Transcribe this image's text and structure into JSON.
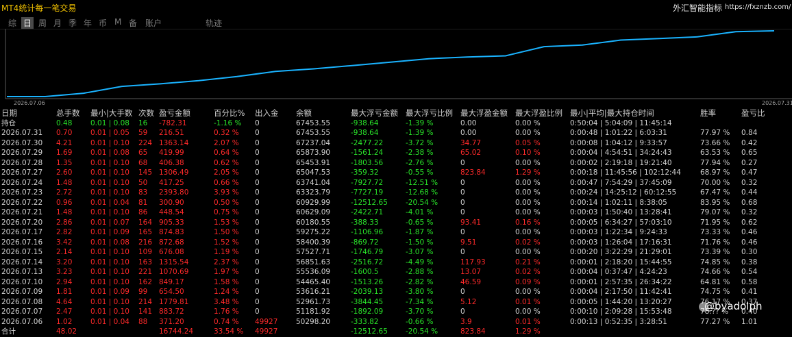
{
  "app": {
    "title": "MT4统计每一笔交易",
    "brand_name": "外汇智能指标",
    "brand_url": "https://fxznzb.com/"
  },
  "tabs": [
    {
      "label": "综",
      "active": false
    },
    {
      "label": "日",
      "active": true
    },
    {
      "label": "周",
      "active": false
    },
    {
      "label": "月",
      "active": false
    },
    {
      "label": "季",
      "active": false
    },
    {
      "label": "年",
      "active": false
    },
    {
      "label": "币",
      "active": false
    },
    {
      "label": "M",
      "active": false
    },
    {
      "label": "备",
      "active": false
    },
    {
      "label": "账户",
      "active": false
    },
    {
      "label": "轨迹",
      "active": false
    }
  ],
  "chart_data": {
    "type": "line",
    "x_start_label": "2026.07.06",
    "x_end_label": "2026.07.31",
    "x": [
      "2026.07.06",
      "2026.07.07",
      "2026.07.08",
      "2026.07.09",
      "2026.07.10",
      "2026.07.13",
      "2026.07.14",
      "2026.07.15",
      "2026.07.16",
      "2026.07.17",
      "2026.07.20",
      "2026.07.21",
      "2026.07.22",
      "2026.07.23",
      "2026.07.24",
      "2026.07.27",
      "2026.07.28",
      "2026.07.29",
      "2026.07.30",
      "2026.07.31"
    ],
    "series": [
      {
        "color": "#1ab3ff",
        "values": [
          50298.2,
          50298.2,
          51181.92,
          52961.73,
          53616.21,
          54465.4,
          55536.09,
          56851.63,
          57527.71,
          58400.39,
          59275.22,
          60180.55,
          60629.09,
          60929.99,
          63323.79,
          63741.04,
          65047.53,
          65453.91,
          65873.9,
          67237.04,
          67453.55
        ]
      }
    ],
    "grid": false
  },
  "table": {
    "headers": [
      "日期",
      "总手数",
      "最小|大手数",
      "次数",
      "盈亏金额",
      "百分比%",
      "出入金",
      "余额",
      "最大浮亏金额",
      "最大浮亏比例",
      "最大浮盈金额",
      "最大浮盈比例",
      "最小|平均|最大持仓时间",
      "胜率",
      "盈亏比"
    ],
    "holding": {
      "label": "持仓",
      "cells": [
        {
          "v": "0.48",
          "c": "green"
        },
        {
          "v": "0.01 | 0.08",
          "c": "green"
        },
        {
          "v": "16",
          "c": "green"
        },
        {
          "v": "-782.31",
          "c": "red"
        },
        {
          "v": "-1.16 %",
          "c": "green"
        },
        {
          "v": "0",
          "c": "white"
        },
        {
          "v": "67453.55",
          "c": "white"
        },
        {
          "v": "-938.64",
          "c": "green"
        },
        {
          "v": "-1.39 %",
          "c": "green"
        },
        {
          "v": "0.00",
          "c": "white"
        },
        {
          "v": "0.00 %",
          "c": "white"
        },
        {
          "v": "0:50:04 | 5:04:09 | 11:45:14",
          "c": "white"
        },
        {
          "v": "",
          "c": "white"
        },
        {
          "v": "",
          "c": "white"
        }
      ]
    },
    "rows": [
      {
        "date": "2026.07.31",
        "lots": "0.70",
        "minmax": "0.01 | 0.05",
        "count": "59",
        "pnl": "216.51",
        "pct": "0.32 %",
        "dep": "0",
        "bal": "67453.55",
        "mfl": "-938.64",
        "mflp": "-1.39 %",
        "mfp": "0.00",
        "mfpp": "0.00 %",
        "time": "0:00:48 | 1:01:22 | 6:03:31",
        "win": "77.97 %",
        "pr": "0.84",
        "mfp_c": "white",
        "mfpp_c": "white"
      },
      {
        "date": "2026.07.30",
        "lots": "4.21",
        "minmax": "0.01 | 0.10",
        "count": "224",
        "pnl": "1363.14",
        "pct": "2.07 %",
        "dep": "0",
        "bal": "67237.04",
        "mfl": "-2477.22",
        "mflp": "-3.72 %",
        "mfp": "34.77",
        "mfpp": "0.05 %",
        "time": "0:00:08 | 1:04:12 | 9:33:57",
        "win": "73.66 %",
        "pr": "0.42",
        "mfp_c": "red",
        "mfpp_c": "red"
      },
      {
        "date": "2026.07.29",
        "lots": "1.69",
        "minmax": "0.01 | 0.08",
        "count": "65",
        "pnl": "419.99",
        "pct": "0.64 %",
        "dep": "0",
        "bal": "65873.90",
        "mfl": "-1561.24",
        "mflp": "-2.38 %",
        "mfp": "65.02",
        "mfpp": "0.10 %",
        "time": "0:00:04 | 4:54:51 | 34:24:43",
        "win": "63.53 %",
        "pr": "0.65",
        "mfp_c": "red",
        "mfpp_c": "red"
      },
      {
        "date": "2026.07.28",
        "lots": "1.35",
        "minmax": "0.01 | 0.10",
        "count": "68",
        "pnl": "406.38",
        "pct": "0.62 %",
        "dep": "0",
        "bal": "65453.91",
        "mfl": "-1803.56",
        "mflp": "-2.76 %",
        "mfp": "0",
        "mfpp": "0.00 %",
        "time": "0:00:02 | 2:19:18 | 19:21:40",
        "win": "77.94 %",
        "pr": "0.27",
        "mfp_c": "white",
        "mfpp_c": "white"
      },
      {
        "date": "2026.07.27",
        "lots": "2.60",
        "minmax": "0.01 | 0.10",
        "count": "145",
        "pnl": "1306.49",
        "pct": "2.05 %",
        "dep": "0",
        "bal": "65047.53",
        "mfl": "-359.32",
        "mflp": "-0.55 %",
        "mfp": "823.84",
        "mfpp": "1.29 %",
        "time": "0:00:18 | 11:45:56 | 102:12:44",
        "win": "68.97 %",
        "pr": "0.47",
        "mfp_c": "red",
        "mfpp_c": "red"
      },
      {
        "date": "2026.07.24",
        "lots": "1.48",
        "minmax": "0.01 | 0.10",
        "count": "50",
        "pnl": "417.25",
        "pct": "0.66 %",
        "dep": "0",
        "bal": "63741.04",
        "mfl": "-7927.72",
        "mflp": "-12.51 %",
        "mfp": "0",
        "mfpp": "0.00 %",
        "time": "0:00:47 | 7:54:29 | 37:45:09",
        "win": "70.00 %",
        "pr": "0.32",
        "mfp_c": "white",
        "mfpp_c": "white"
      },
      {
        "date": "2026.07.23",
        "lots": "2.72",
        "minmax": "0.01 | 0.10",
        "count": "83",
        "pnl": "2393.80",
        "pct": "3.93 %",
        "dep": "0",
        "bal": "63323.79",
        "mfl": "-7727.19",
        "mflp": "-12.68 %",
        "mfp": "0",
        "mfpp": "0.00 %",
        "time": "0:00:24 | 14:25:12 | 60:12:55",
        "win": "67.47 %",
        "pr": "0.44",
        "mfp_c": "white",
        "mfpp_c": "white"
      },
      {
        "date": "2026.07.22",
        "lots": "0.96",
        "minmax": "0.01 | 0.04",
        "count": "81",
        "pnl": "300.90",
        "pct": "0.50 %",
        "dep": "0",
        "bal": "60929.99",
        "mfl": "-12512.65",
        "mflp": "-20.54 %",
        "mfp": "0",
        "mfpp": "0.00 %",
        "time": "0:00:14 | 1:02:11 | 8:38:05",
        "win": "83.95 %",
        "pr": "0.68",
        "mfp_c": "white",
        "mfpp_c": "white"
      },
      {
        "date": "2026.07.21",
        "lots": "1.48",
        "minmax": "0.01 | 0.10",
        "count": "86",
        "pnl": "448.54",
        "pct": "0.75 %",
        "dep": "0",
        "bal": "60629.09",
        "mfl": "-2422.71",
        "mflp": "-4.01 %",
        "mfp": "0",
        "mfpp": "0.00 %",
        "time": "0:00:03 | 1:50:40 | 13:28:41",
        "win": "79.07 %",
        "pr": "0.32",
        "mfp_c": "white",
        "mfpp_c": "white"
      },
      {
        "date": "2026.07.20",
        "lots": "2.86",
        "minmax": "0.01 | 0.07",
        "count": "164",
        "pnl": "905.33",
        "pct": "1.53 %",
        "dep": "0",
        "bal": "60180.55",
        "mfl": "-388.33",
        "mflp": "-0.65 %",
        "mfp": "93.41",
        "mfpp": "0.16 %",
        "time": "0:00:05 | 6:34:27 | 57:03:10",
        "win": "71.95 %",
        "pr": "0.62",
        "mfp_c": "red",
        "mfpp_c": "red"
      },
      {
        "date": "2026.07.17",
        "lots": "2.82",
        "minmax": "0.01 | 0.09",
        "count": "165",
        "pnl": "874.83",
        "pct": "1.50 %",
        "dep": "0",
        "bal": "59275.22",
        "mfl": "-1106.96",
        "mflp": "-1.87 %",
        "mfp": "0",
        "mfpp": "0.00 %",
        "time": "0:00:03 | 1:22:34 | 9:24:33",
        "win": "73.33 %",
        "pr": "0.46",
        "mfp_c": "white",
        "mfpp_c": "white"
      },
      {
        "date": "2026.07.16",
        "lots": "3.42",
        "minmax": "0.01 | 0.08",
        "count": "216",
        "pnl": "872.68",
        "pct": "1.52 %",
        "dep": "0",
        "bal": "58400.39",
        "mfl": "-869.72",
        "mflp": "-1.50 %",
        "mfp": "9.51",
        "mfpp": "0.02 %",
        "time": "0:00:03 | 1:26:04 | 17:16:31",
        "win": "71.76 %",
        "pr": "0.46",
        "mfp_c": "red",
        "mfpp_c": "red"
      },
      {
        "date": "2026.07.15",
        "lots": "2.14",
        "minmax": "0.01 | 0.10",
        "count": "109",
        "pnl": "676.08",
        "pct": "1.19 %",
        "dep": "0",
        "bal": "57527.71",
        "mfl": "-1746.79",
        "mflp": "-3.07 %",
        "mfp": "0",
        "mfpp": "0.00 %",
        "time": "0:00:20 | 3:22:29 | 21:29:01",
        "win": "73.39 %",
        "pr": "0.30",
        "mfp_c": "white",
        "mfpp_c": "white"
      },
      {
        "date": "2026.07.14",
        "lots": "3.20",
        "minmax": "0.01 | 0.10",
        "count": "163",
        "pnl": "1315.54",
        "pct": "2.37 %",
        "dep": "0",
        "bal": "56851.63",
        "mfl": "-2516.72",
        "mflp": "-4.49 %",
        "mfp": "117.93",
        "mfpp": "0.21 %",
        "time": "0:00:01 | 2:18:20 | 15:44:55",
        "win": "74.85 %",
        "pr": "0.38",
        "mfp_c": "red",
        "mfpp_c": "red"
      },
      {
        "date": "2026.07.13",
        "lots": "3.23",
        "minmax": "0.01 | 0.10",
        "count": "221",
        "pnl": "1070.69",
        "pct": "1.97 %",
        "dep": "0",
        "bal": "55536.09",
        "mfl": "-1600.5",
        "mflp": "-2.88 %",
        "mfp": "13.07",
        "mfpp": "0.02 %",
        "time": "0:00:04 | 0:37:47 | 4:24:23",
        "win": "74.66 %",
        "pr": "0.54",
        "mfp_c": "red",
        "mfpp_c": "red"
      },
      {
        "date": "2026.07.10",
        "lots": "2.94",
        "minmax": "0.01 | 0.10",
        "count": "162",
        "pnl": "849.17",
        "pct": "1.58 %",
        "dep": "0",
        "bal": "54465.40",
        "mfl": "-1513.26",
        "mflp": "-2.82 %",
        "mfp": "46.59",
        "mfpp": "0.09 %",
        "time": "0:00:01 | 2:57:35 | 26:34:22",
        "win": "64.81 %",
        "pr": "0.58",
        "mfp_c": "red",
        "mfpp_c": "red"
      },
      {
        "date": "2026.07.09",
        "lots": "1.81",
        "minmax": "0.01 | 0.09",
        "count": "99",
        "pnl": "654.50",
        "pct": "1.24 %",
        "dep": "0",
        "bal": "53616.21",
        "mfl": "-2039.13",
        "mflp": "-3.80 %",
        "mfp": "0",
        "mfpp": "0.00 %",
        "time": "0:00:04 | 2:17:50 | 11:42:41",
        "win": "74.75 %",
        "pr": "0.41",
        "mfp_c": "white",
        "mfpp_c": "white"
      },
      {
        "date": "2026.07.08",
        "lots": "4.64",
        "minmax": "0.01 | 0.10",
        "count": "214",
        "pnl": "1779.81",
        "pct": "3.48 %",
        "dep": "0",
        "bal": "52961.73",
        "mfl": "-3844.45",
        "mflp": "-7.34 %",
        "mfp": "5.12",
        "mfpp": "0.01 %",
        "time": "0:00:05 | 1:44:20 | 13:20:27",
        "win": "76.17 %",
        "pr": "0.37",
        "mfp_c": "red",
        "mfpp_c": "red"
      },
      {
        "date": "2026.07.07",
        "lots": "2.47",
        "minmax": "0.01 | 0.10",
        "count": "141",
        "pnl": "883.72",
        "pct": "1.76 %",
        "dep": "0",
        "bal": "51181.92",
        "mfl": "-1892.09",
        "mflp": "-3.70 %",
        "mfp": "0",
        "mfpp": "0.00 %",
        "time": "0:00:10 | 2:09:28 | 15:53:48",
        "win": "78.?? %",
        "pr": "0.40",
        "mfp_c": "white",
        "mfpp_c": "white"
      },
      {
        "date": "2026.07.06",
        "lots": "1.02",
        "minmax": "0.01 | 0.04",
        "count": "88",
        "pnl": "371.20",
        "pct": "0.74 %",
        "dep": "49927",
        "bal": "50298.20",
        "mfl": "-333.82",
        "mflp": "-0.66 %",
        "mfp": "3.9",
        "mfpp": "0.01 %",
        "time": "0:00:13 | 0:52:35 | 3:28:51",
        "win": "77.27 %",
        "pr": "1.01",
        "mfp_c": "red",
        "mfpp_c": "red"
      }
    ],
    "total": {
      "label": "合计",
      "lots": "48.02",
      "pnl": "16744.24",
      "pct": "33.54 %",
      "dep": "49927",
      "mfl": "-12512.65",
      "mflp": "-20.54 %",
      "mfp": "823.84",
      "mfpp": "1.29 %"
    }
  },
  "watermark": "@byadolph",
  "colors": {
    "line": "#1ab3ff",
    "profit": "#ff2a2a",
    "loss": "#29e329",
    "title": "#f0c000"
  }
}
